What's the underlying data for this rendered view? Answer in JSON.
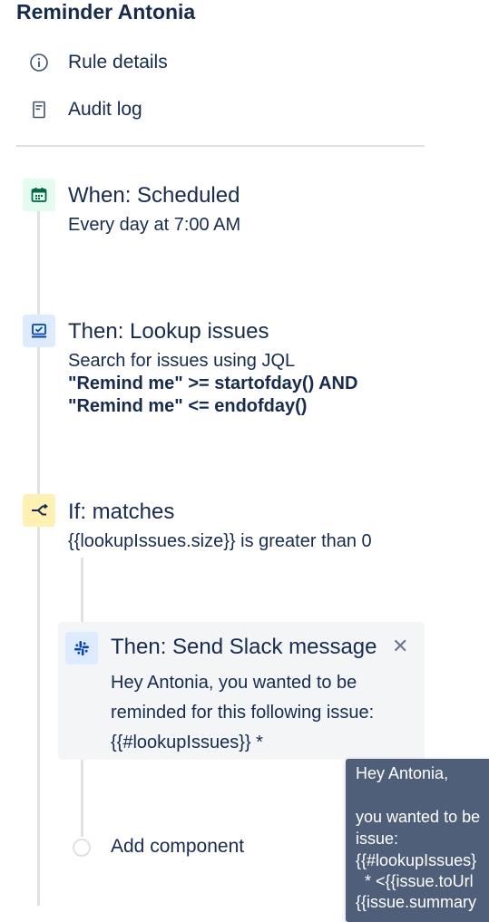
{
  "header": {
    "title": "Reminder Antonia"
  },
  "nav": {
    "rule_details": "Rule details",
    "audit_log": "Audit log"
  },
  "trigger": {
    "title": "When: Scheduled",
    "subtitle": "Every day at 7:00 AM",
    "icon": "calendar-icon",
    "color": "#e3fcef"
  },
  "lookup": {
    "title": "Then: Lookup issues",
    "subtitle": "Search for issues using JQL",
    "jql_line1": "\"Remind me\" >= startofday() AND",
    "jql_line2": "\"Remind me\" <= endofday()",
    "icon": "monitor-icon",
    "color": "#deebff"
  },
  "condition": {
    "title": "If: matches",
    "subtitle": "{{lookupIssues.size}} is greater than 0",
    "icon": "branch-icon",
    "color": "#fff0b3"
  },
  "slack": {
    "title": "Then: Send Slack message",
    "body_line1": "Hey Antonia, you wanted to be",
    "body_line2": "reminded for this following issue:",
    "body_line3": "{{#lookupIssues}} *",
    "icon": "slack-icon"
  },
  "add_component": "Add component",
  "tooltip": {
    "line1": "Hey Antonia,",
    "line2": "you wanted to be",
    "line3": "issue:",
    "line4": "{{#lookupIssues}",
    "line5": "  * <{{issue.toUrl",
    "line6": "{{issue.summary"
  }
}
